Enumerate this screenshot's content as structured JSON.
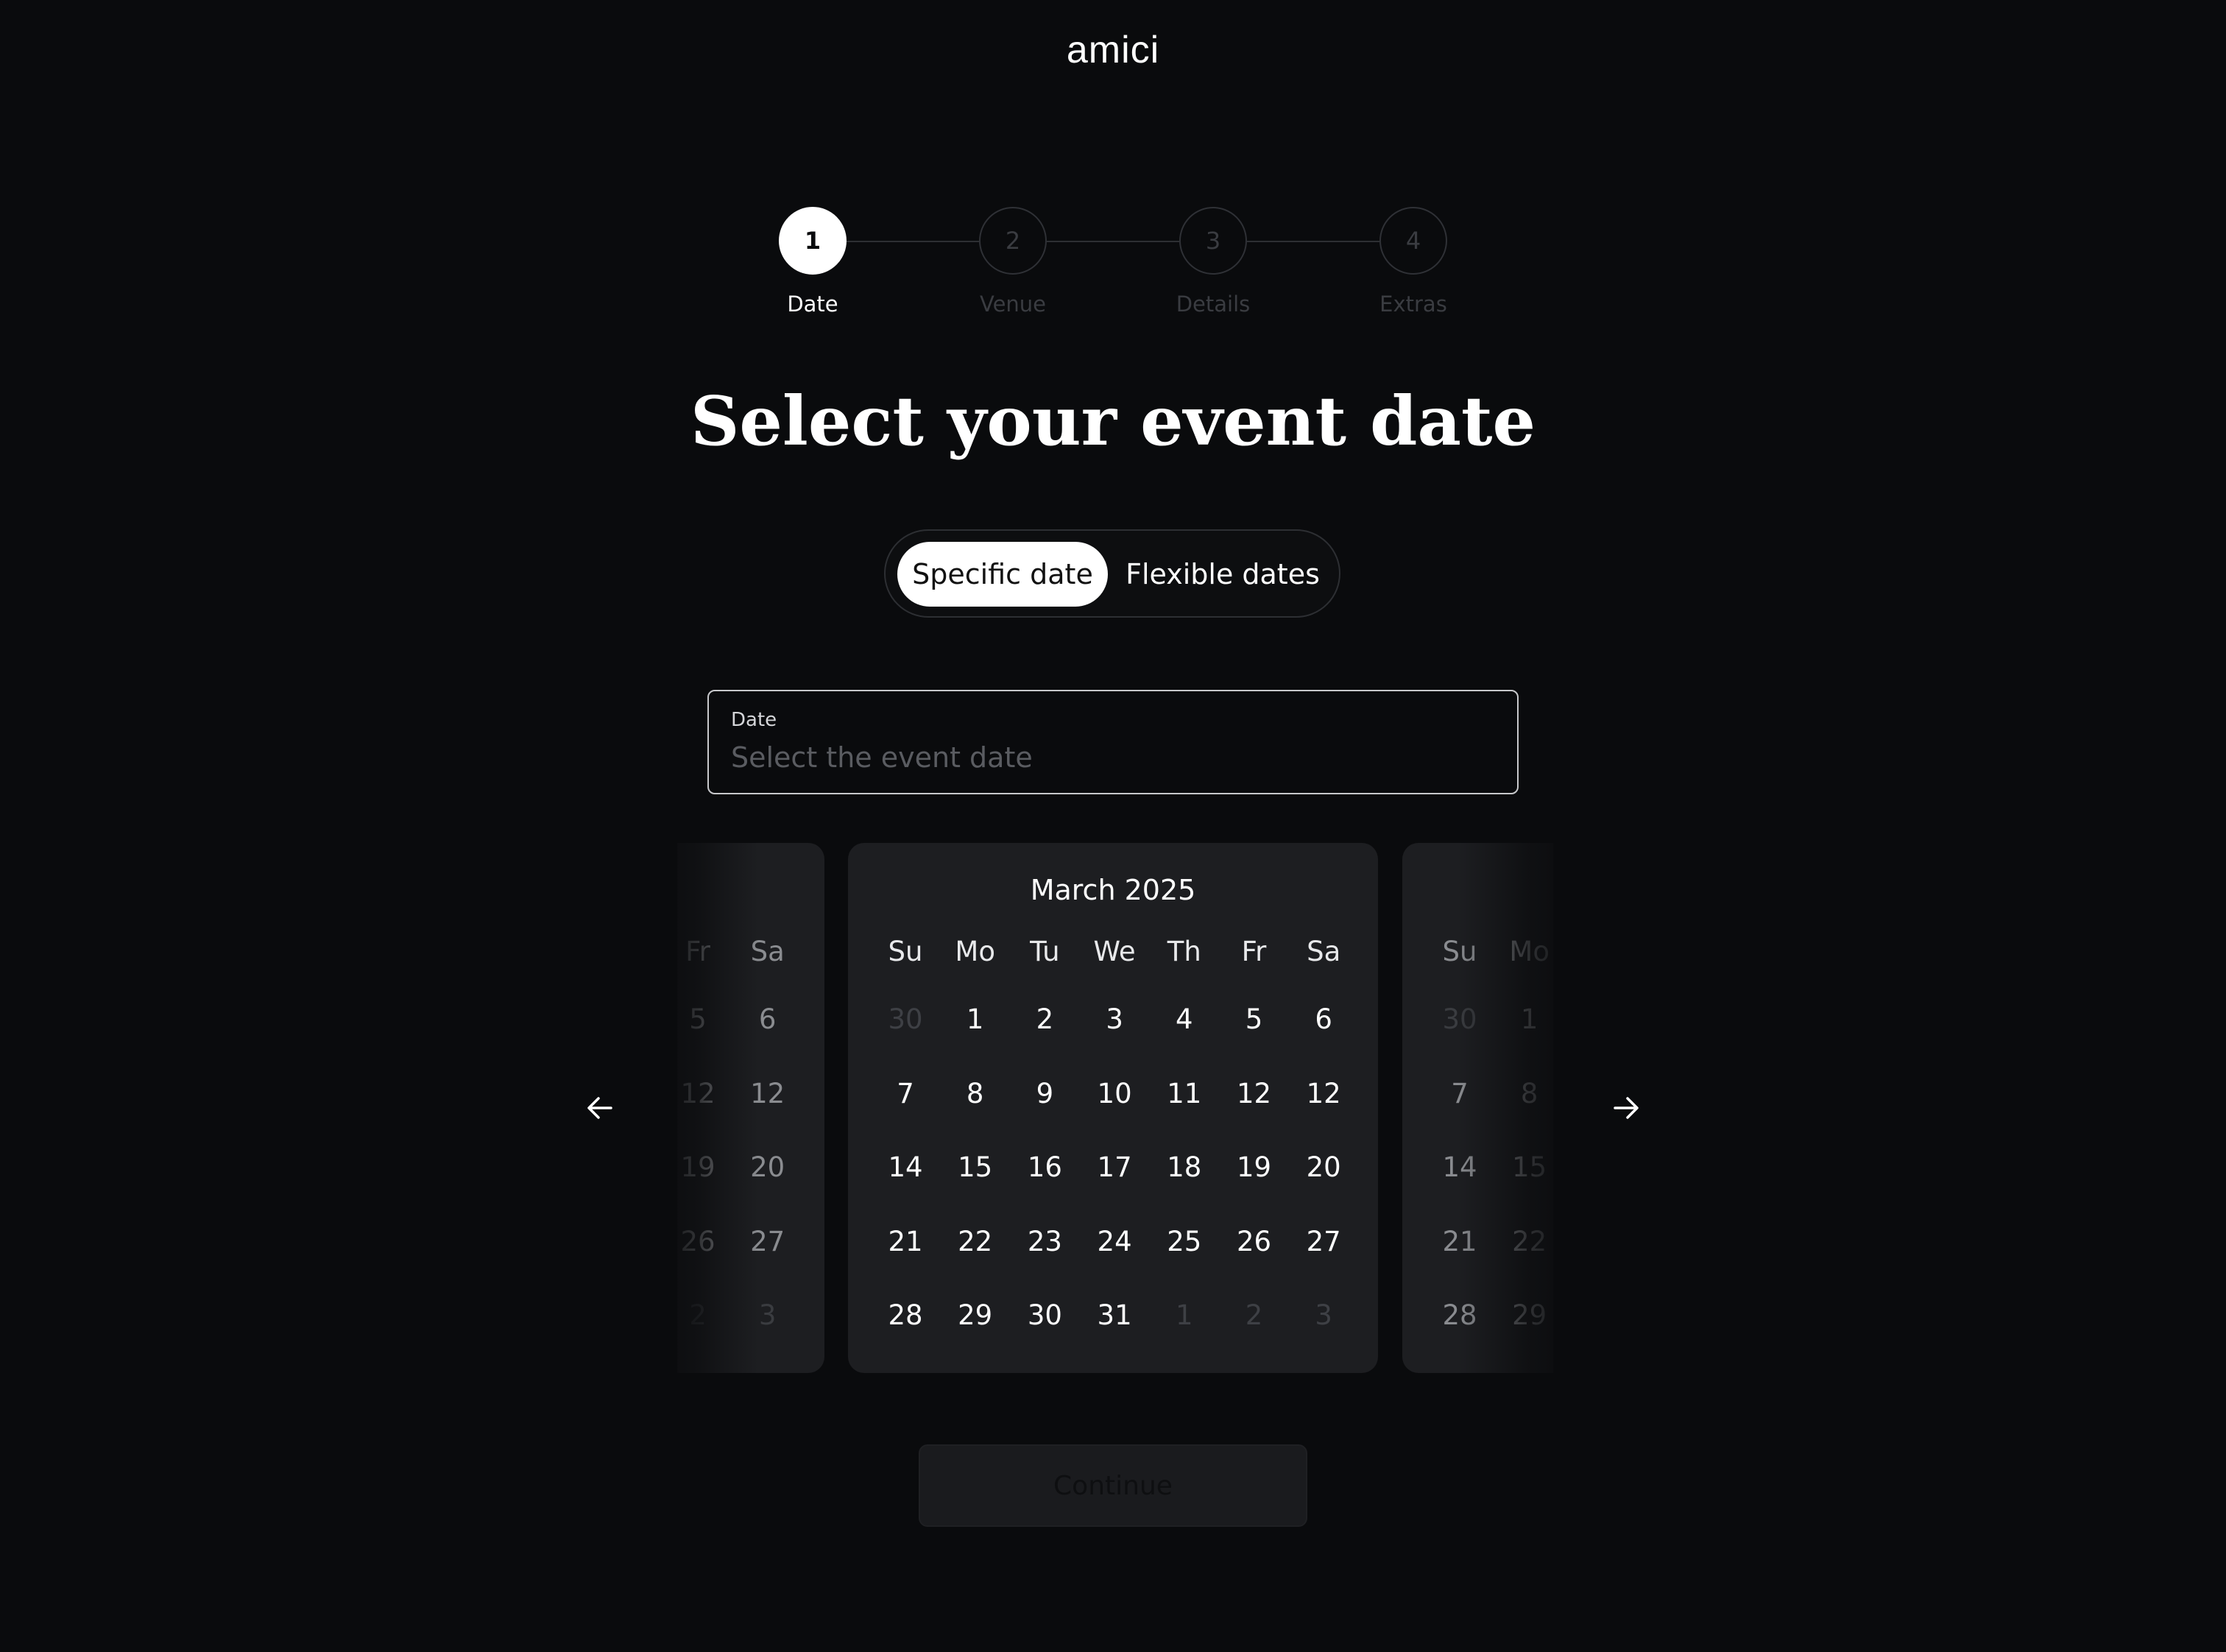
{
  "brand": "amici",
  "stepper": [
    {
      "number": "1",
      "label": "Date",
      "active": true
    },
    {
      "number": "2",
      "label": "Venue",
      "active": false
    },
    {
      "number": "3",
      "label": "Details",
      "active": false
    },
    {
      "number": "4",
      "label": "Extras",
      "active": false
    }
  ],
  "title": "Select your event date",
  "toggle": {
    "selected": "Specific date",
    "other": "Flexible dates"
  },
  "date_field": {
    "label": "Date",
    "placeholder": "Select the event date"
  },
  "calendar_main": {
    "title": "March 2025",
    "weekdays": [
      "Su",
      "Mo",
      "Tu",
      "We",
      "Th",
      "Fr",
      "Sa"
    ],
    "weeks": [
      [
        {
          "d": "30",
          "dim": true
        },
        {
          "d": "1"
        },
        {
          "d": "2"
        },
        {
          "d": "3"
        },
        {
          "d": "4"
        },
        {
          "d": "5"
        },
        {
          "d": "6"
        }
      ],
      [
        {
          "d": "7"
        },
        {
          "d": "8"
        },
        {
          "d": "9"
        },
        {
          "d": "10"
        },
        {
          "d": "11"
        },
        {
          "d": "12"
        },
        {
          "d": "12"
        }
      ],
      [
        {
          "d": "14"
        },
        {
          "d": "15"
        },
        {
          "d": "16"
        },
        {
          "d": "17"
        },
        {
          "d": "18"
        },
        {
          "d": "19"
        },
        {
          "d": "20"
        }
      ],
      [
        {
          "d": "21"
        },
        {
          "d": "22"
        },
        {
          "d": "23"
        },
        {
          "d": "24"
        },
        {
          "d": "25"
        },
        {
          "d": "26"
        },
        {
          "d": "27"
        }
      ],
      [
        {
          "d": "28"
        },
        {
          "d": "29"
        },
        {
          "d": "30"
        },
        {
          "d": "31"
        },
        {
          "d": "1",
          "dim": true
        },
        {
          "d": "2",
          "dim": true
        },
        {
          "d": "3",
          "dim": true
        }
      ]
    ]
  },
  "calendar_prev": {
    "weekdays": [
      "Fr",
      "Sa"
    ],
    "weeks": [
      [
        {
          "d": "5"
        },
        {
          "d": "6"
        }
      ],
      [
        {
          "d": "12"
        },
        {
          "d": "12"
        }
      ],
      [
        {
          "d": "19"
        },
        {
          "d": "20"
        }
      ],
      [
        {
          "d": "26"
        },
        {
          "d": "27"
        }
      ],
      [
        {
          "d": "2",
          "dim": true
        },
        {
          "d": "3",
          "dim": true
        }
      ]
    ]
  },
  "calendar_next": {
    "weekdays": [
      "Su",
      "Mo"
    ],
    "weeks": [
      [
        {
          "d": "30",
          "dim": true
        },
        {
          "d": "1"
        }
      ],
      [
        {
          "d": "7"
        },
        {
          "d": "8"
        }
      ],
      [
        {
          "d": "14"
        },
        {
          "d": "15"
        }
      ],
      [
        {
          "d": "21"
        },
        {
          "d": "22"
        }
      ],
      [
        {
          "d": "28"
        },
        {
          "d": "29"
        }
      ]
    ]
  },
  "nav": {
    "prev_icon": "arrow-left-icon",
    "next_icon": "arrow-right-icon"
  },
  "continue_label": "Continue",
  "colors": {
    "background": "#0a0b0d",
    "card": "#1d1e21",
    "active": "#ffffff",
    "muted": "#3a3c41"
  }
}
